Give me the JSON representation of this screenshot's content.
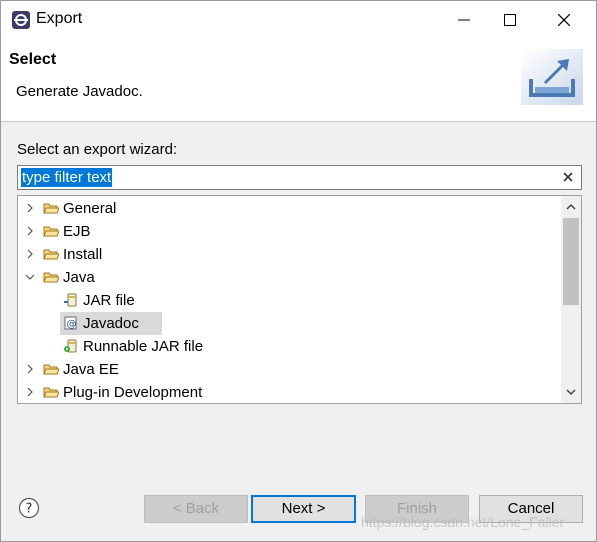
{
  "window": {
    "title": "Export",
    "min_icon": "minimize-icon",
    "max_icon": "maximize-icon",
    "close_icon": "close-icon"
  },
  "banner": {
    "title": "Select",
    "description": "Generate Javadoc.",
    "image": "export-wizard-banner-icon"
  },
  "wizard": {
    "label": "Select an export wizard:",
    "filter": {
      "value": "type filter text",
      "clear_icon": "clear-icon"
    },
    "tree": [
      {
        "label": "General",
        "expanded": false,
        "icon": "folder-icon"
      },
      {
        "label": "EJB",
        "expanded": false,
        "icon": "folder-icon"
      },
      {
        "label": "Install",
        "expanded": false,
        "icon": "folder-icon"
      },
      {
        "label": "Java",
        "expanded": true,
        "icon": "folder-icon"
      },
      {
        "label": "JAR file",
        "icon": "jar-file-icon"
      },
      {
        "label": "Javadoc",
        "icon": "javadoc-icon",
        "selected": true
      },
      {
        "label": "Runnable JAR file",
        "icon": "runnable-jar-icon"
      },
      {
        "label": "Java EE",
        "expanded": false,
        "icon": "folder-icon"
      },
      {
        "label": "Plug-in Development",
        "expanded": false,
        "icon": "folder-icon"
      }
    ]
  },
  "footer": {
    "help_icon": "help-icon",
    "back": "< Back",
    "next": "Next >",
    "finish": "Finish",
    "cancel": "Cancel",
    "watermark": "https://blog.csdn.net/Lone_Faller"
  },
  "colors": {
    "selection": "#0078d7",
    "primary_border": "#0078d7",
    "tree_selected": "#d9d9d9"
  }
}
